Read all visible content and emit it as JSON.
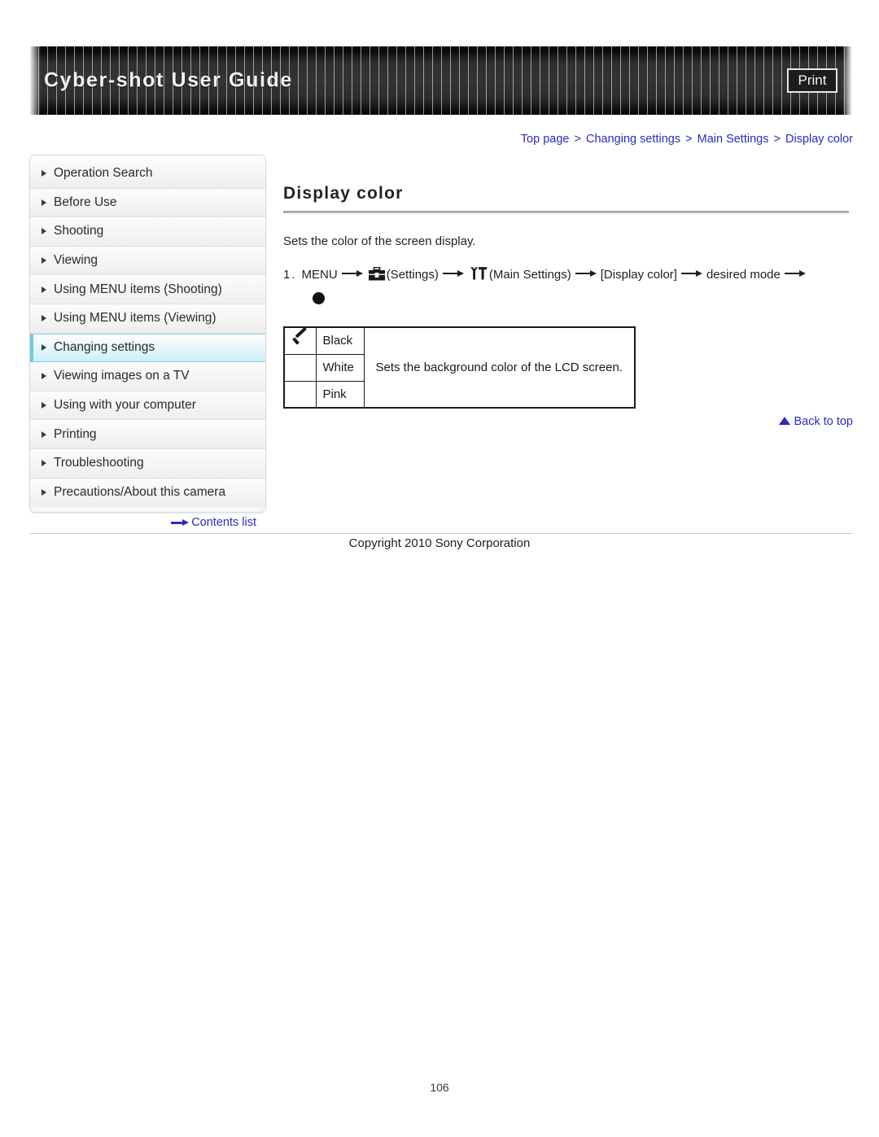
{
  "header": {
    "title": "Cyber-shot User Guide",
    "print_label": "Print"
  },
  "breadcrumb": {
    "separator": ">",
    "items": [
      {
        "label": "Top page"
      },
      {
        "label": "Changing settings"
      },
      {
        "label": "Main Settings"
      },
      {
        "label": "Display color"
      }
    ]
  },
  "sidebar": {
    "items": [
      {
        "label": "Operation Search",
        "active": false
      },
      {
        "label": "Before Use",
        "active": false
      },
      {
        "label": "Shooting",
        "active": false
      },
      {
        "label": "Viewing",
        "active": false
      },
      {
        "label": "Using MENU items (Shooting)",
        "active": false
      },
      {
        "label": "Using MENU items (Viewing)",
        "active": false
      },
      {
        "label": "Changing settings",
        "active": true
      },
      {
        "label": "Viewing images on a TV",
        "active": false
      },
      {
        "label": "Using with your computer",
        "active": false
      },
      {
        "label": "Printing",
        "active": false
      },
      {
        "label": "Troubleshooting",
        "active": false
      },
      {
        "label": "Precautions/About this camera",
        "active": false
      }
    ],
    "contents_list_label": "Contents list"
  },
  "main": {
    "title": "Display color",
    "intro": "Sets the color of the screen display.",
    "step": {
      "number": "1.",
      "menu_label": "MENU",
      "settings_label": "(Settings)",
      "main_settings_label": "(Main Settings)",
      "display_color_label": "[Display color]",
      "desired_mode_label": "desired mode"
    },
    "table": {
      "rows": [
        {
          "checked": true,
          "option": "Black"
        },
        {
          "checked": false,
          "option": "White"
        },
        {
          "checked": false,
          "option": "Pink"
        }
      ],
      "description": "Sets the background color of the LCD screen."
    },
    "back_to_top_label": "Back to top"
  },
  "footer": {
    "copyright": "Copyright 2010 Sony Corporation",
    "page_number": "106"
  }
}
